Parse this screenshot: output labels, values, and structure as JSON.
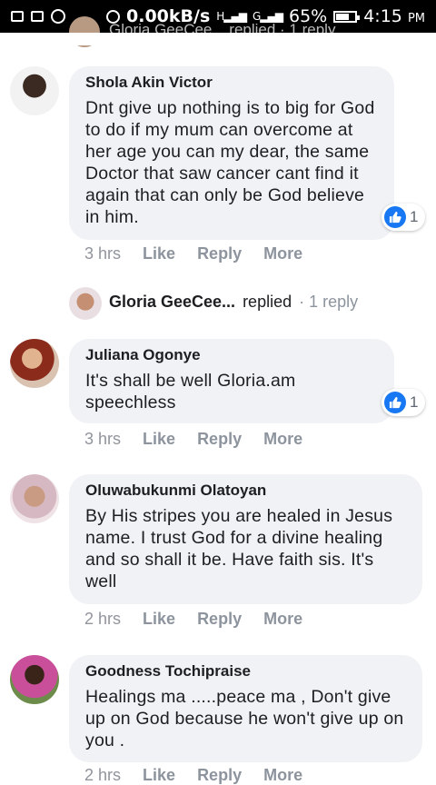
{
  "statusbar": {
    "speed": "0.00kB/s",
    "signal1": "H",
    "signal2": "G",
    "battery": "65%",
    "time": "4:15",
    "ampm": "PM"
  },
  "cut_comment": {
    "text": "Gloria GeeCee... replied · 1 reply"
  },
  "comments": [
    {
      "author": "Shola Akin Victor",
      "text": "Dnt give up nothing is to big for God to do if my mum can overcome at her age you can my dear, the same Doctor that saw cancer cant find it again that can only be God believe in him.",
      "time": "3 hrs",
      "like": "Like",
      "reply": "Reply",
      "more": "More",
      "reactions": "1"
    },
    {
      "author": "Juliana Ogonye",
      "text": "It's shall be well Gloria.am speechless",
      "time": "3 hrs",
      "like": "Like",
      "reply": "Reply",
      "more": "More",
      "reactions": "1"
    },
    {
      "author": "Oluwabukunmi Olatoyan",
      "text": "By His stripes you are healed in Jesus name. I trust God for a divine healing and so shall it be. Have faith sis. It's well",
      "time": "2 hrs",
      "like": "Like",
      "reply": "Reply",
      "more": "More"
    },
    {
      "author": "Goodness Tochipraise",
      "text": "Healings ma .....peace ma , Don't give up on God because he won't give up on you .",
      "time": "2 hrs",
      "like": "Like",
      "reply": "Reply",
      "more": "More"
    }
  ],
  "replied": {
    "name": "Gloria GeeCee...",
    "verb": "replied",
    "count": "· 1 reply"
  },
  "colors": {
    "like_blue": "#1877f2",
    "bubble": "#f0f2f5",
    "meta": "#90949c"
  }
}
